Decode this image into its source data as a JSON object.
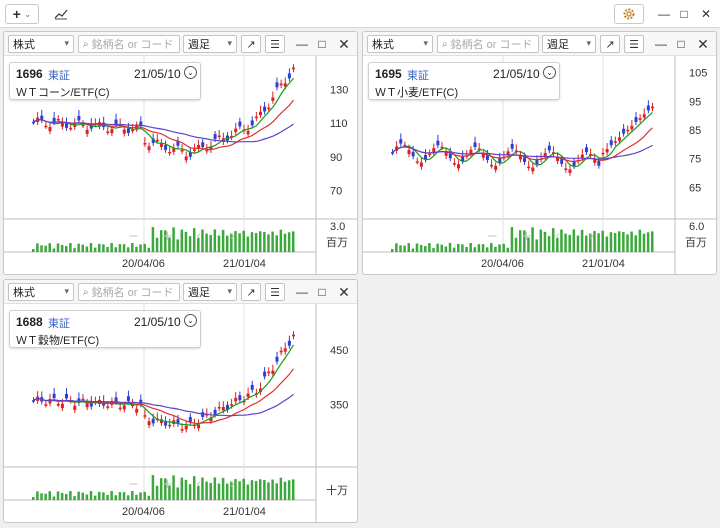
{
  "toolbar": {
    "add_label": "+",
    "add_arrow": "⌄",
    "chart_icon": "chart-line-icon",
    "settings_icon": "gear-icon",
    "win_min": "—",
    "win_max": "□",
    "win_close": "✕"
  },
  "common": {
    "market_select": "株式",
    "search_placeholder": "銘柄名 or コード",
    "period_select": "週足",
    "search_icon": "🔍"
  },
  "panels": [
    {
      "code": "1696",
      "exchange": "東証",
      "date": "21/05/10",
      "name": "ＷＴコーン/ETF(C)",
      "price_ticks": [
        "130",
        "110",
        "90",
        "70"
      ],
      "volume_tick": "3.0",
      "volume_unit": "百万",
      "date_ticks": [
        "20/04/06",
        "21/01/04"
      ]
    },
    {
      "code": "1695",
      "exchange": "東証",
      "date": "21/05/10",
      "name": "ＷＴ小麦/ETF(C)",
      "price_ticks": [
        "105",
        "95",
        "85",
        "75",
        "65"
      ],
      "volume_tick": "6.0",
      "volume_unit": "百万",
      "date_ticks": [
        "20/04/06",
        "21/01/04"
      ]
    },
    {
      "code": "1688",
      "exchange": "東証",
      "date": "21/05/10",
      "name": "ＷＴ穀物/ETF(C)",
      "price_ticks": [
        "450",
        "350"
      ],
      "volume_tick": "",
      "volume_unit": "十万",
      "date_ticks": [
        "20/04/06",
        "21/01/04"
      ]
    }
  ],
  "colors": {
    "up": "#e02020",
    "down": "#2a3fd8",
    "ma_short": "#1a9a1a",
    "ma_mid": "#e03030",
    "ma_long": "#6040c8",
    "volume": "#3aa83a"
  }
}
